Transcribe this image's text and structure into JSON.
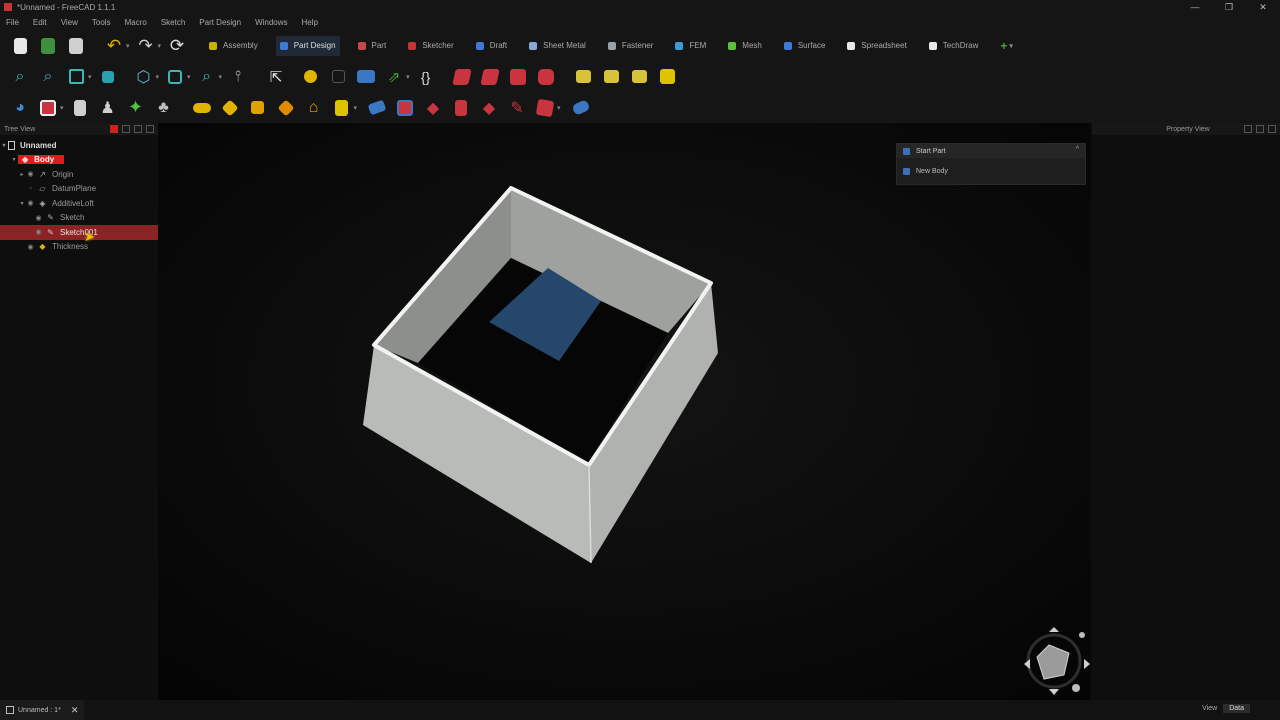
{
  "window": {
    "title": "*Unnamed - FreeCAD 1.1.1",
    "minimize": "—",
    "maximize": "❐",
    "close": "✕"
  },
  "menu": [
    "File",
    "Edit",
    "View",
    "Tools",
    "Macro",
    "Sketch",
    "Part Design",
    "Windows",
    "Help"
  ],
  "workbenches": [
    {
      "label": "Assembly",
      "color": "#c9b200"
    },
    {
      "label": "Part Design",
      "color": "#3d7ad6",
      "active": true
    },
    {
      "label": "Part",
      "color": "#c24a4a"
    },
    {
      "label": "Sketcher",
      "color": "#c23535"
    },
    {
      "label": "Draft",
      "color": "#3d7ad6"
    },
    {
      "label": "Sheet Metal",
      "color": "#8aa8d6"
    },
    {
      "label": "Fastener",
      "color": "#9aa0a6"
    },
    {
      "label": "FEM",
      "color": "#3d9ad6"
    },
    {
      "label": "Mesh",
      "color": "#5fbf3c"
    },
    {
      "label": "Surface",
      "color": "#3d7ad6"
    },
    {
      "label": "Spreadsheet",
      "color": "#e8e8e8"
    },
    {
      "label": "TechDraw",
      "color": "#e8e8e8"
    },
    {
      "label": "+",
      "color": "#4aa33a"
    }
  ],
  "tree": {
    "panel_title": "Tree View",
    "items": [
      {
        "label": "Unnamed",
        "icon": "document-icon"
      },
      {
        "label": "Body",
        "icon": "body-icon"
      },
      {
        "label": "Origin",
        "icon": "origin-icon"
      },
      {
        "label": "DatumPlane",
        "icon": "datum-plane-icon"
      },
      {
        "label": "AdditiveLoft",
        "icon": "loft-icon"
      },
      {
        "label": "Sketch",
        "icon": "sketch-icon"
      },
      {
        "label": "Sketch001",
        "icon": "sketch-icon"
      },
      {
        "label": "Thickness",
        "icon": "thickness-icon"
      }
    ]
  },
  "task_panel": {
    "title": "Start Part",
    "item": "New Body",
    "collapse": "^"
  },
  "property_view": {
    "title": "Property View"
  },
  "status": {
    "doc_tab": "Unnamed : 1*",
    "close": "✕",
    "nav_left": "View",
    "nav_right": "Data"
  },
  "colors": {
    "accent_red": "#e01b1b",
    "selection": "#8a2424",
    "shell_face": "#b9bbb8",
    "inner_wall": "#8d8f8c",
    "base_blue": "#24476b"
  }
}
